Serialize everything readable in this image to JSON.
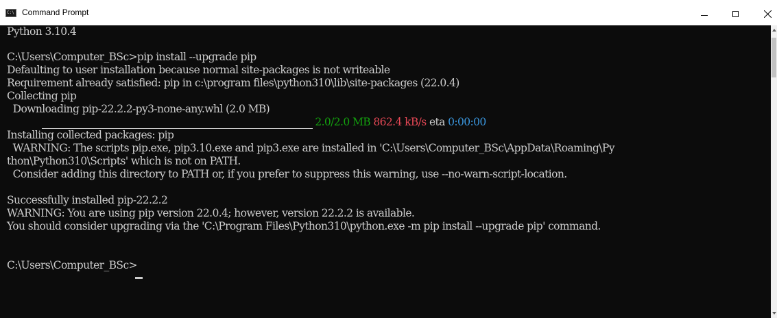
{
  "window": {
    "title": "Command Prompt",
    "icon_glyph": "C:\\",
    "icon": "cmd-app-icon"
  },
  "title_buttons": {
    "minimize_icon": "minimize-icon",
    "maximize_icon": "maximize-icon",
    "close_icon": "close-icon"
  },
  "colors": {
    "background": "#0c0c0c",
    "text": "#cccccc",
    "progress_complete": "#13a10e",
    "speed": "#e74856",
    "eta": "#3a96dd"
  },
  "console": {
    "lines": [
      "Python 3.10.4",
      "C:\\Users\\Computer_BSc>pip install --upgrade pip",
      "Defaulting to user installation because normal site-packages is not writeable",
      "Requirement already satisfied: pip in c:\\program files\\python310\\lib\\site-packages (22.0.4)",
      "Collecting pip",
      "  Downloading pip-22.2.2-py3-none-any.whl (2.0 MB)",
      "Installing collected packages: pip",
      "  WARNING: The scripts pip.exe, pip3.10.exe and pip3.exe are installed in 'C:\\Users\\Computer_BSc\\AppData\\Roaming\\Py",
      "thon\\Python310\\Scripts' which is not on PATH.",
      "  Consider adding this directory to PATH or, if you prefer to suppress this warning, use --no-warn-script-location.",
      "Successfully installed pip-22.2.2",
      "WARNING: You are using pip version 22.0.4; however, version 22.2.2 is available.",
      "You should consider upgrading via the 'C:\\Program Files\\Python310\\python.exe -m pip install --upgrade pip' command."
    ],
    "progress": {
      "fraction": 1.0,
      "size": "2.0/2.0 MB",
      "speed": "862.4 kB/s",
      "eta_label": "eta",
      "eta": "0:00:00"
    },
    "prompt": "C:\\Users\\Computer_BSc>"
  }
}
